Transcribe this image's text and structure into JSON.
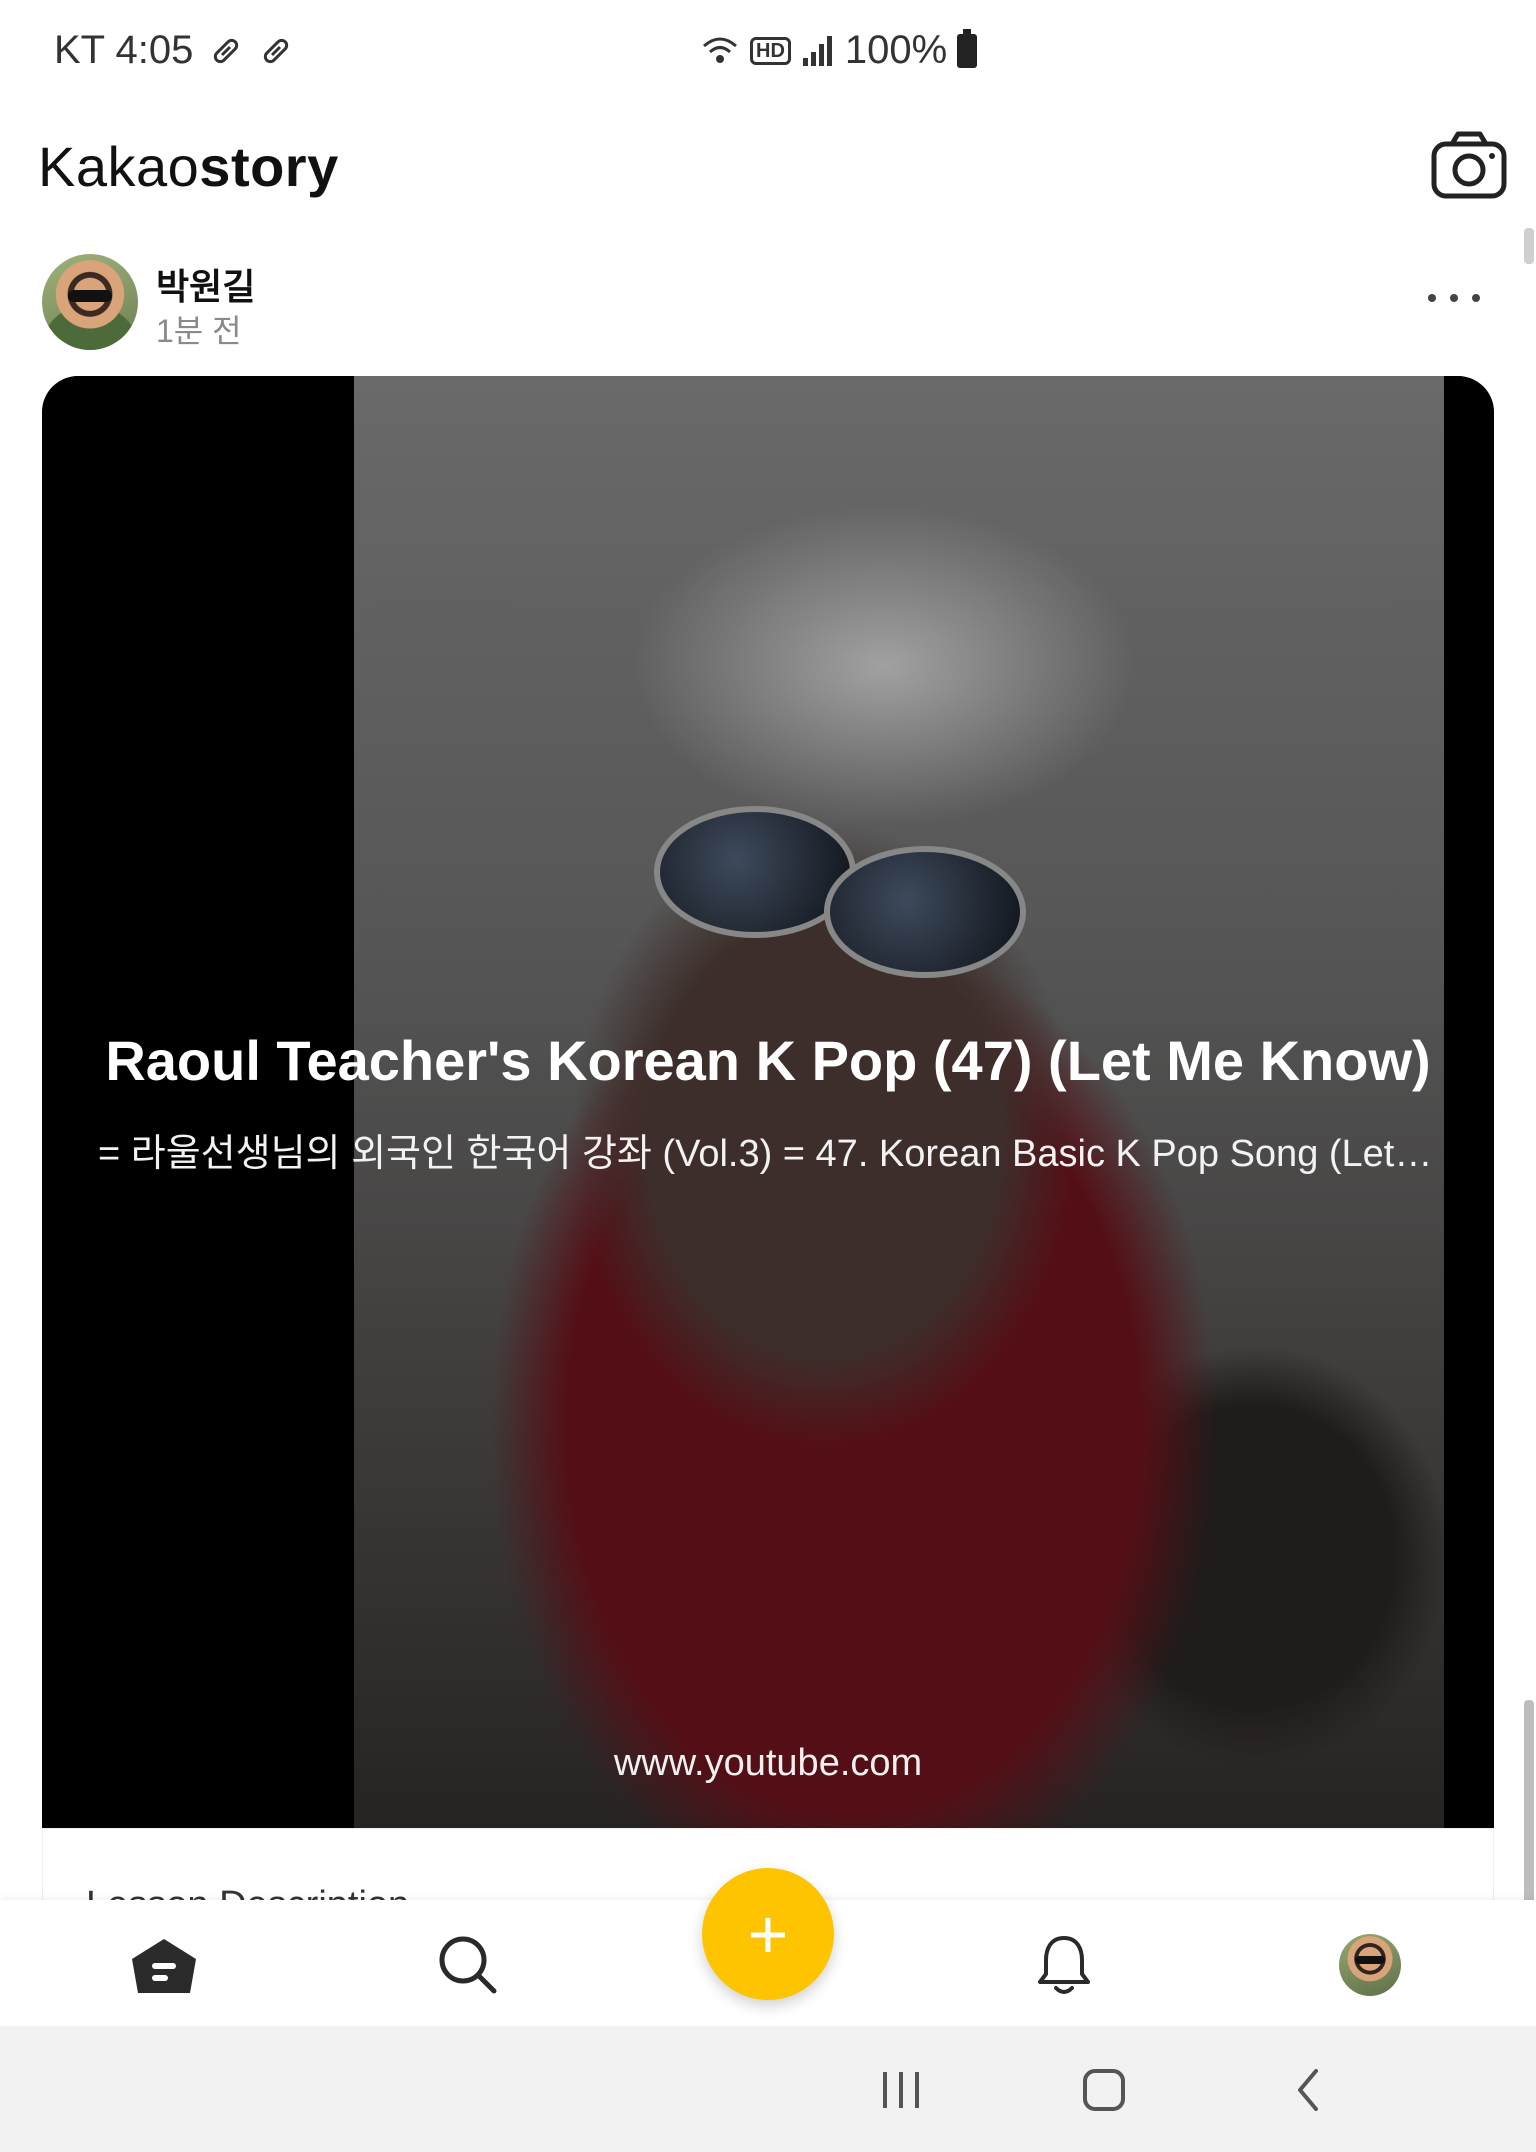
{
  "status_bar": {
    "carrier_time": "KT 4:05",
    "battery": "100%",
    "icons": [
      "pill-icon",
      "pill-icon",
      "wifi-icon",
      "hd-icon",
      "signal-icon",
      "battery-icon"
    ]
  },
  "app": {
    "title_light": "Kakao",
    "title_bold": "story",
    "camera_icon": "camera-icon"
  },
  "post": {
    "author": "박원길",
    "time": "1분 전",
    "more_icon": "more-dots-icon",
    "video": {
      "title": "Raoul Teacher's Korean K Pop (47) (Let Me Know)",
      "description": "= 라울선생님의 외국인 한국어 강좌 (Vol.3) =  47. Korean Basic  K Pop  Song  (Let Me Know)",
      "domain": "www.youtube.com"
    },
    "below_text": "Lesson Description"
  },
  "bottom_nav": {
    "items": [
      {
        "name": "home",
        "icon": "home-icon"
      },
      {
        "name": "search",
        "icon": "search-icon"
      },
      {
        "name": "add",
        "icon": "plus-icon",
        "label": "+"
      },
      {
        "name": "notifications",
        "icon": "bell-icon"
      },
      {
        "name": "profile",
        "icon": "avatar"
      }
    ]
  },
  "system_nav": {
    "items": [
      "recents-icon",
      "home-circle-icon",
      "back-icon"
    ]
  },
  "colors": {
    "accent": "#ffc400",
    "text": "#111111",
    "muted": "#8a8a8a"
  }
}
